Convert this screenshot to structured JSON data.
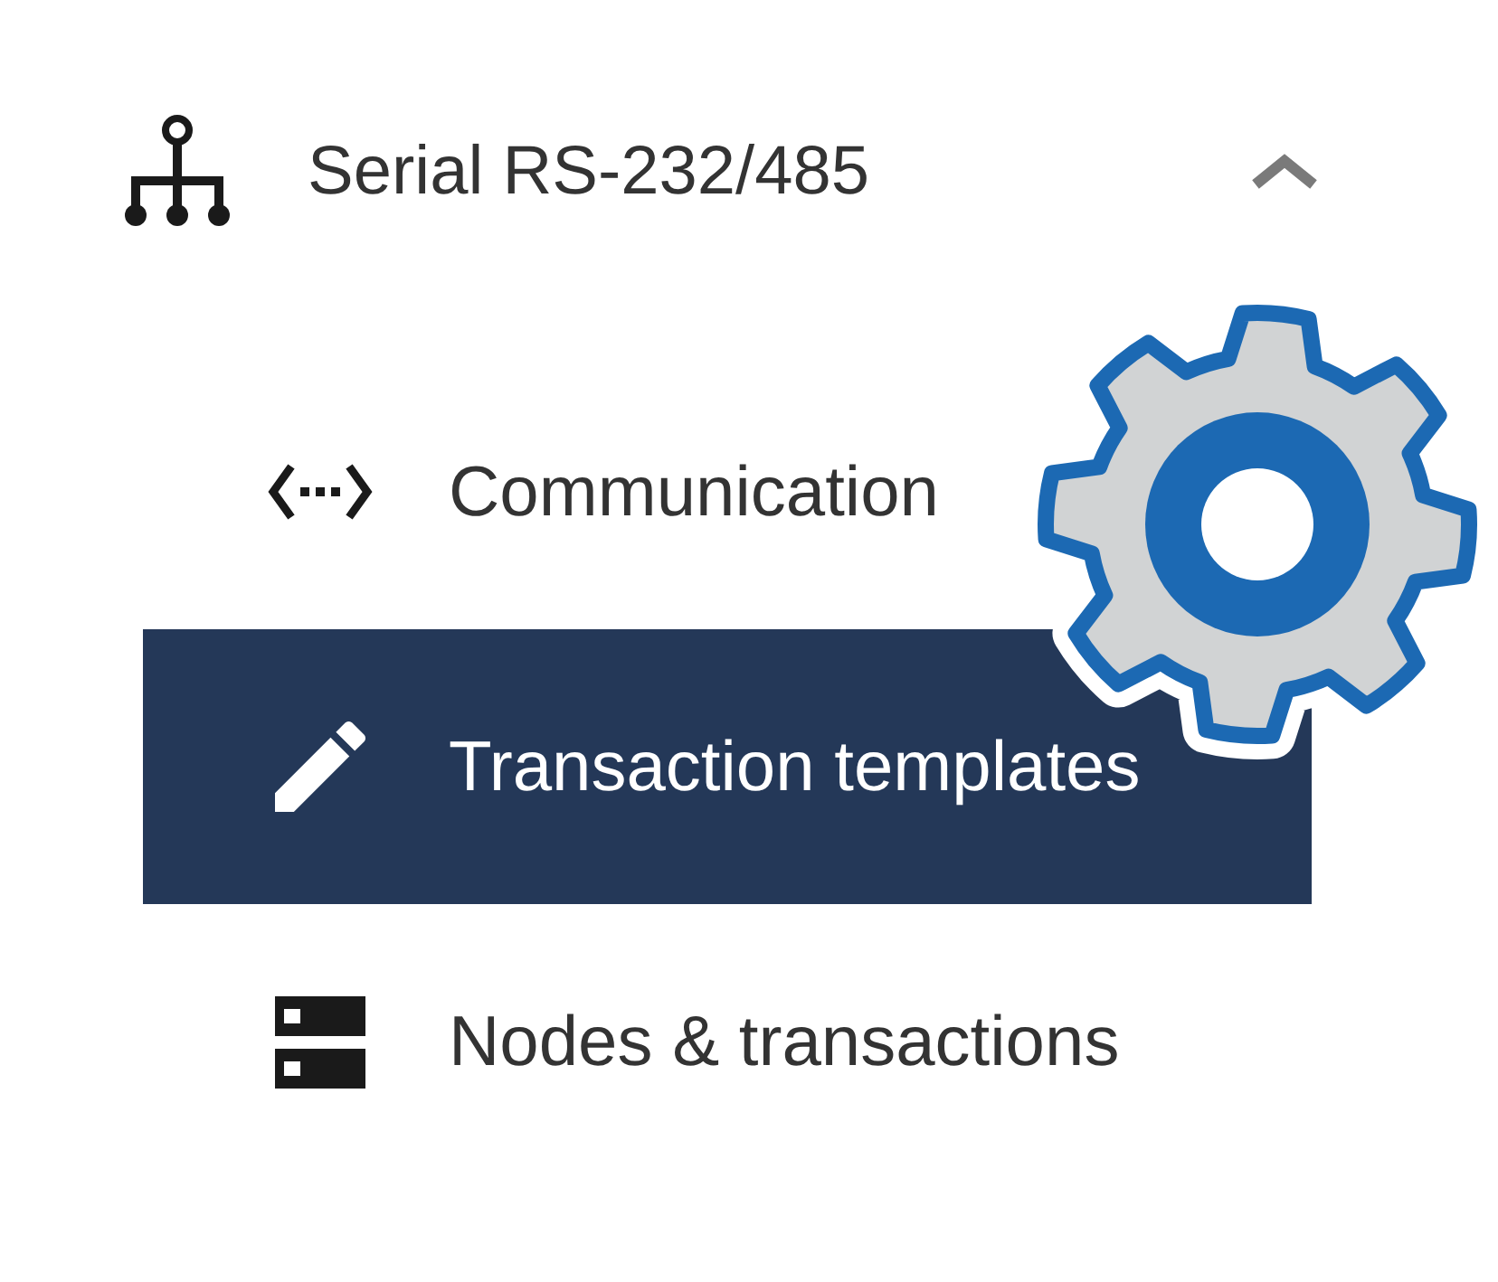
{
  "nav": {
    "group": {
      "label": "Serial RS-232/485",
      "expanded": true,
      "items": [
        {
          "label": "Communication",
          "selected": false
        },
        {
          "label": "Transaction templates",
          "selected": true
        },
        {
          "label": "Nodes & transactions",
          "selected": false
        }
      ]
    }
  }
}
